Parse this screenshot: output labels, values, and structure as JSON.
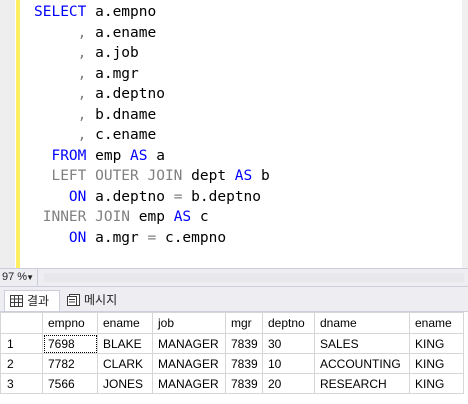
{
  "editor": {
    "lines": [
      [
        {
          "t": "SELECT",
          "c": "kw"
        },
        {
          "t": " a.empno",
          "c": ""
        }
      ],
      [
        {
          "t": "     , ",
          "c": "op"
        },
        {
          "t": "a.ename",
          "c": ""
        }
      ],
      [
        {
          "t": "     , ",
          "c": "op"
        },
        {
          "t": "a.job",
          "c": ""
        }
      ],
      [
        {
          "t": "     , ",
          "c": "op"
        },
        {
          "t": "a.mgr",
          "c": ""
        }
      ],
      [
        {
          "t": "     , ",
          "c": "op"
        },
        {
          "t": "a.deptno",
          "c": ""
        }
      ],
      [
        {
          "t": "     , ",
          "c": "op"
        },
        {
          "t": "b.dname",
          "c": ""
        }
      ],
      [
        {
          "t": "     , ",
          "c": "op"
        },
        {
          "t": "c.ename",
          "c": ""
        }
      ],
      [
        {
          "t": "  FROM",
          "c": "kw"
        },
        {
          "t": " emp ",
          "c": ""
        },
        {
          "t": "AS",
          "c": "kw"
        },
        {
          "t": " a",
          "c": ""
        }
      ],
      [
        {
          "t": "  LEFT OUTER JOIN",
          "c": "kw-grey"
        },
        {
          "t": " dept ",
          "c": ""
        },
        {
          "t": "AS",
          "c": "kw"
        },
        {
          "t": " b",
          "c": ""
        }
      ],
      [
        {
          "t": "    ON",
          "c": "kw"
        },
        {
          "t": " a.deptno ",
          "c": ""
        },
        {
          "t": "=",
          "c": "op"
        },
        {
          "t": " b.deptno",
          "c": ""
        }
      ],
      [
        {
          "t": " INNER JOIN",
          "c": "kw-grey"
        },
        {
          "t": " emp ",
          "c": ""
        },
        {
          "t": "AS",
          "c": "kw"
        },
        {
          "t": " c",
          "c": ""
        }
      ],
      [
        {
          "t": "    ON",
          "c": "kw"
        },
        {
          "t": " a.mgr ",
          "c": ""
        },
        {
          "t": "=",
          "c": "op"
        },
        {
          "t": " c.empno",
          "c": ""
        }
      ]
    ]
  },
  "zoom": {
    "value": "97 %"
  },
  "tabs": [
    {
      "label": "결과",
      "icon": "grid-icon"
    },
    {
      "label": "메시지",
      "icon": "messages-icon"
    }
  ],
  "grid": {
    "columns": [
      "",
      "empno",
      "ename",
      "job",
      "mgr",
      "deptno",
      "dname",
      "ename"
    ],
    "rows": [
      [
        "1",
        "7698",
        "BLAKE",
        "MANAGER",
        "7839",
        "30",
        "SALES",
        "KING"
      ],
      [
        "2",
        "7782",
        "CLARK",
        "MANAGER",
        "7839",
        "10",
        "ACCOUNTING",
        "KING"
      ],
      [
        "3",
        "7566",
        "JONES",
        "MANAGER",
        "7839",
        "20",
        "RESEARCH",
        "KING"
      ]
    ]
  },
  "colors": {
    "keyword": "#0000ff",
    "keyword_grey": "#808080",
    "changebar": "#ffee62"
  }
}
